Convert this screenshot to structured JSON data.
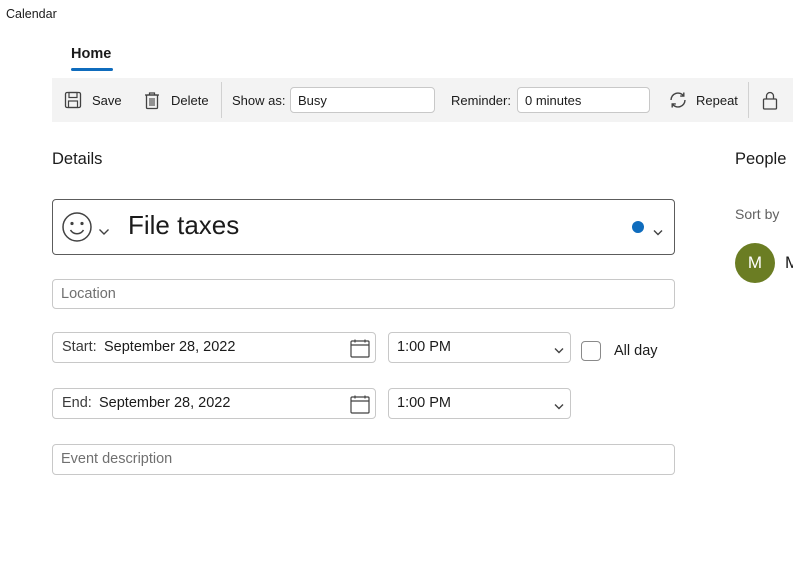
{
  "app": {
    "title": "Calendar"
  },
  "tabs": [
    {
      "label": "Home",
      "selected": true
    }
  ],
  "toolbar": {
    "save_label": "Save",
    "delete_label": "Delete",
    "show_as_label": "Show as:",
    "show_as_value": "Busy",
    "reminder_label": "Reminder:",
    "reminder_value": "0 minutes",
    "repeat_label": "Repeat",
    "icons": [
      "save-icon",
      "delete-icon",
      "repeat-icon",
      "lock-icon"
    ]
  },
  "details": {
    "heading": "Details",
    "event_title": "File taxes",
    "category_color": "#0f6cbd",
    "location_placeholder": "Location",
    "start": {
      "label": "Start:",
      "date": "September 28, 2022",
      "time": "1:00 PM"
    },
    "end": {
      "label": "End:",
      "date": "September 28, 2022",
      "time": "1:00 PM"
    },
    "all_day_label": "All day",
    "all_day_checked": false,
    "description_placeholder": "Event description"
  },
  "people": {
    "heading": "People",
    "sort_label": "Sort by",
    "attendees": [
      {
        "initial": "M",
        "name": "M",
        "avatar_color": "#6b7d23"
      }
    ]
  },
  "colors": {
    "accent": "#0f6cbd",
    "toolbar_bg": "#f3f3f3"
  }
}
